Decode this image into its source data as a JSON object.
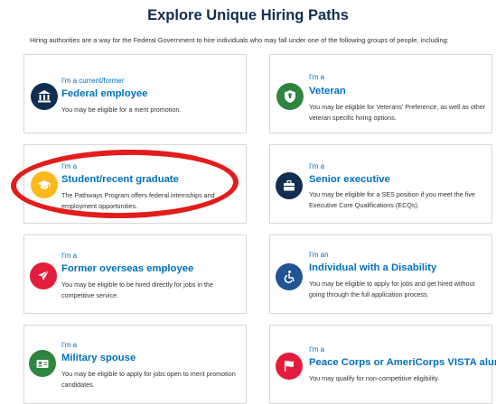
{
  "page": {
    "title": "Explore Unique Hiring Paths",
    "intro": "Hiring authorities are a way for the Federal Government to hire individuals who may fall under one of the following groups of people, including:"
  },
  "cards": [
    {
      "prefix": "I'm a current/former",
      "title": "Federal employee",
      "desc": "You may be eligible for a merit promotion.",
      "icon": "building-icon",
      "color": "#112e51"
    },
    {
      "prefix": "I'm a",
      "title": "Veteran",
      "desc": "You may be eligible for Veterans' Preference, as well as other veteran specific hiring options.",
      "icon": "shield-icon",
      "color": "#2e8540"
    },
    {
      "prefix": "I'm a",
      "title": "Student/recent graduate",
      "desc": "The Pathways Program offers federal internships and employment opportunities.",
      "icon": "graduation-cap-icon",
      "color": "#fdb81e"
    },
    {
      "prefix": "I'm a",
      "title": "Senior executive",
      "desc": "You may be eligible for a SES position if you meet the five Executive Core Qualifications (ECQs).",
      "icon": "briefcase-icon",
      "color": "#112e51"
    },
    {
      "prefix": "I'm a",
      "title": "Former overseas employee",
      "desc": "You may be eligible to be hired directly for jobs in the competitive service.",
      "icon": "airplane-icon",
      "color": "#e31c3d"
    },
    {
      "prefix": "I'm an",
      "title": "Individual with a Disability",
      "desc": "You may be eligible to apply for jobs and get hired without going through the full application process.",
      "icon": "wheelchair-icon",
      "color": "#205493"
    },
    {
      "prefix": "I'm a",
      "title": "Military spouse",
      "desc": "You may be eligible to apply for jobs open to merit promotion candidates.",
      "icon": "military-id-icon",
      "color": "#2e8540"
    },
    {
      "prefix": "I'm a",
      "title": "Peace Corps or AmeriCorps VISTA alumni",
      "desc": "You may qualify for non-competitive eligibility.",
      "icon": "flag-icon",
      "color": "#e31c3d"
    }
  ]
}
